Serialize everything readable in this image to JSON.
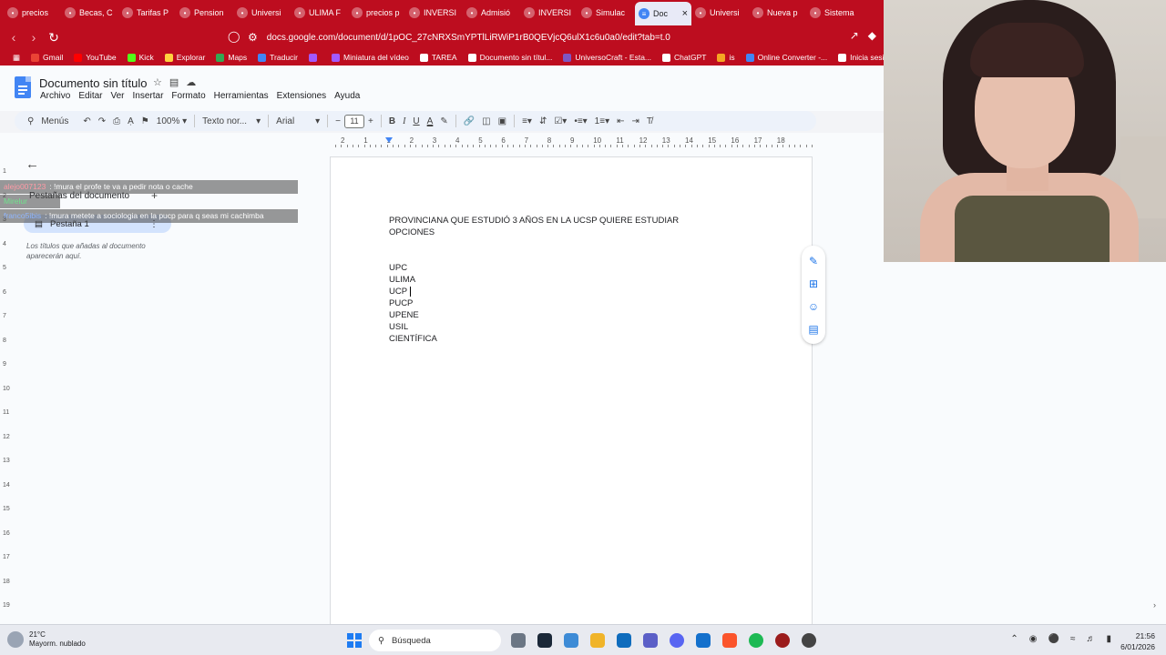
{
  "browser": {
    "tabs": [
      {
        "title": "precios",
        "icon": "google-icon",
        "color": "#ffffff",
        "active": false
      },
      {
        "title": "Becas, C",
        "icon": "ucsp-icon",
        "color": "#ffffff",
        "active": false
      },
      {
        "title": "Tarifas P",
        "icon": "ucsp-icon",
        "color": "#ffffff",
        "active": false
      },
      {
        "title": "Pension",
        "icon": "ucsp-icon",
        "color": "#ffffff",
        "active": false
      },
      {
        "title": "Universi",
        "icon": "globe-icon",
        "color": "#ffffff",
        "active": false
      },
      {
        "title": "ULIMA F",
        "icon": "google-icon",
        "color": "#ffffff",
        "active": false
      },
      {
        "title": "precios p",
        "icon": "google-icon",
        "color": "#ffffff",
        "active": false
      },
      {
        "title": "INVERSI",
        "icon": "gear-icon",
        "color": "#ffffff",
        "active": false
      },
      {
        "title": "Admisió",
        "icon": "gear-icon",
        "color": "#ffffff",
        "active": false
      },
      {
        "title": "INVERSI",
        "icon": "gear-icon",
        "color": "#ffffff",
        "active": false
      },
      {
        "title": "Simulac",
        "icon": "globe-icon",
        "color": "#ffffff",
        "active": false
      },
      {
        "title": "Doc",
        "icon": "docs-icon",
        "color": "#202124",
        "active": true
      },
      {
        "title": "Universi",
        "icon": "globe-icon",
        "color": "#ffffff",
        "active": false
      },
      {
        "title": "Nueva p",
        "icon": "brave-icon",
        "color": "#ffffff",
        "active": false
      },
      {
        "title": "Sistema",
        "icon": "sistema-icon",
        "color": "#ffffff",
        "active": false
      }
    ],
    "url": "docs.google.com/document/d/1pOC_27cNRXSmYPTlLiRWiP1rB0QEVjcQ6ulX1c6u0a0/edit?tab=t.0",
    "bookmarks": [
      {
        "label": "Gmail",
        "color": "#ea4335"
      },
      {
        "label": "YouTube",
        "color": "#ff0000"
      },
      {
        "label": "Kick",
        "color": "#53fc18"
      },
      {
        "label": "Explorar",
        "color": "#ffd23f"
      },
      {
        "label": "Maps",
        "color": "#34a853"
      },
      {
        "label": "Traducir",
        "color": "#4285f4"
      },
      {
        "label": "",
        "color": "#a259ff"
      },
      {
        "label": "Miniatura del vídeo",
        "color": "#a259ff"
      },
      {
        "label": "TAREA",
        "color": "#ffffff"
      },
      {
        "label": "Documento sin títul...",
        "color": "#ffffff"
      },
      {
        "label": "UniversoCraft - Esta...",
        "color": "#7e57c2"
      },
      {
        "label": "ChatGPT",
        "color": "#ffffff"
      },
      {
        "label": "is",
        "color": "#f5a623"
      },
      {
        "label": "Online Converter -...",
        "color": "#4285f4"
      },
      {
        "label": "Inicia sesión: Cuen",
        "color": "#ffffff"
      }
    ]
  },
  "docs": {
    "title": "Documento sin título",
    "menu": [
      "Archivo",
      "Editar",
      "Ver",
      "Insertar",
      "Formato",
      "Herramientas",
      "Extensiones",
      "Ayuda"
    ],
    "toolbar": {
      "menus_label": "Menús",
      "zoom": "100%",
      "style": "Texto nor...",
      "font": "Arial",
      "font_size": "11"
    },
    "ruler_numbers": [
      "2",
      "1",
      "1",
      "2",
      "3",
      "4",
      "5",
      "6",
      "7",
      "8",
      "9",
      "10",
      "11",
      "12",
      "13",
      "14",
      "15",
      "16",
      "17",
      "18"
    ],
    "vruler_numbers": [
      "1",
      "2",
      "3",
      "4",
      "5",
      "6",
      "7",
      "8",
      "9",
      "10",
      "11",
      "12",
      "13",
      "14",
      "15",
      "16",
      "17",
      "18",
      "19"
    ],
    "sidebar": {
      "title": "Pestañas del documento",
      "tab_label": "Pestaña 1",
      "hint": "Los títulos que añadas al documento aparecerán aquí."
    },
    "document": {
      "heading": "PROVINCIANA QUE ESTUDIÓ 3 AÑOS EN LA UCSP QUIERE ESTUDIAR OPCIONES",
      "items": [
        "UPC",
        "ULIMA",
        "UCP",
        "PUCP",
        "UPENE",
        "USIL",
        "CIENTÍFICA"
      ]
    }
  },
  "chat": [
    {
      "user": "alejo007123",
      "message": ": !mura el profe te va a pedir nota o cache",
      "color": "#ff9aa6"
    },
    {
      "user": "Mirelur",
      "message": "",
      "color": "#6fe38c"
    },
    {
      "user": "franco5ibis",
      "message": ": !mura metete a sociologia en la pucp para q seas mi cachimba",
      "color": "#8fb6ff"
    }
  ],
  "taskbar": {
    "temperature": "21°C",
    "weather": "Mayorm. nublado",
    "search_label": "Búsqueda",
    "time": "21:56",
    "date": "6/01/2026"
  }
}
